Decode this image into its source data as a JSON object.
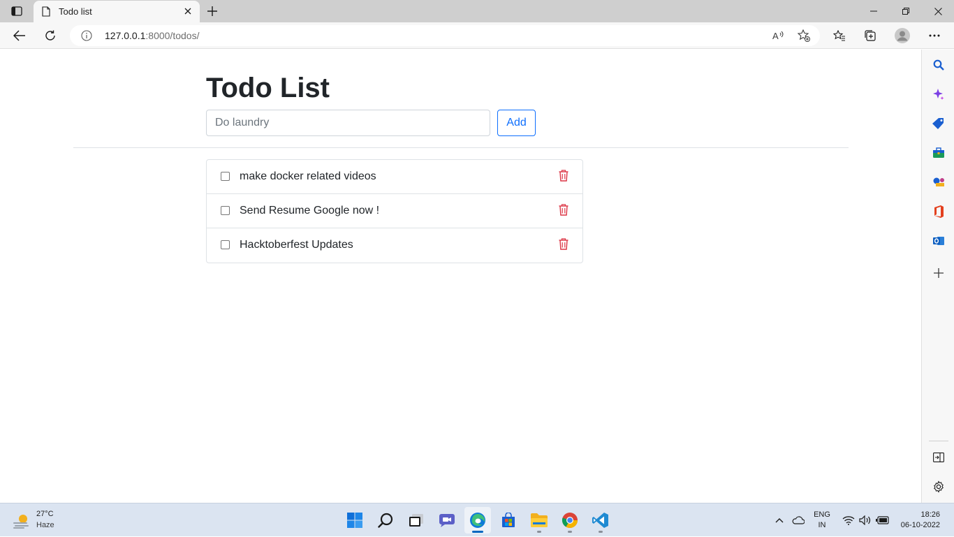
{
  "browser": {
    "tab": {
      "title": "Todo list"
    },
    "address": {
      "host": "127.0.0.1",
      "path": ":8000/todos/"
    }
  },
  "page": {
    "title": "Todo List",
    "input": {
      "placeholder": "Do laundry",
      "value": ""
    },
    "add_label": "Add",
    "todos": [
      {
        "text": "make docker related videos",
        "done": false
      },
      {
        "text": "Send Resume Google now !",
        "done": false
      },
      {
        "text": "Hacktoberfest Updates",
        "done": false
      }
    ]
  },
  "sidebar": {
    "icons": [
      "search-icon",
      "copilot-icon",
      "shopping-tag-icon",
      "tools-icon",
      "games-icon",
      "office-icon",
      "outlook-icon",
      "add-icon",
      "split-screen-icon",
      "settings-icon"
    ]
  },
  "taskbar": {
    "weather": {
      "temp": "27°C",
      "condition": "Haze"
    },
    "lang": {
      "line1": "ENG",
      "line2": "IN"
    },
    "clock": {
      "time": "18:26",
      "date": "06-10-2022"
    },
    "apps": [
      "start-icon",
      "search-icon",
      "task-view-icon",
      "chat-icon",
      "edge-icon",
      "store-icon",
      "file-explorer-icon",
      "chrome-icon",
      "vscode-icon"
    ]
  },
  "colors": {
    "primary": "#0d6efd",
    "danger": "#dc3545",
    "title": "#212529"
  }
}
